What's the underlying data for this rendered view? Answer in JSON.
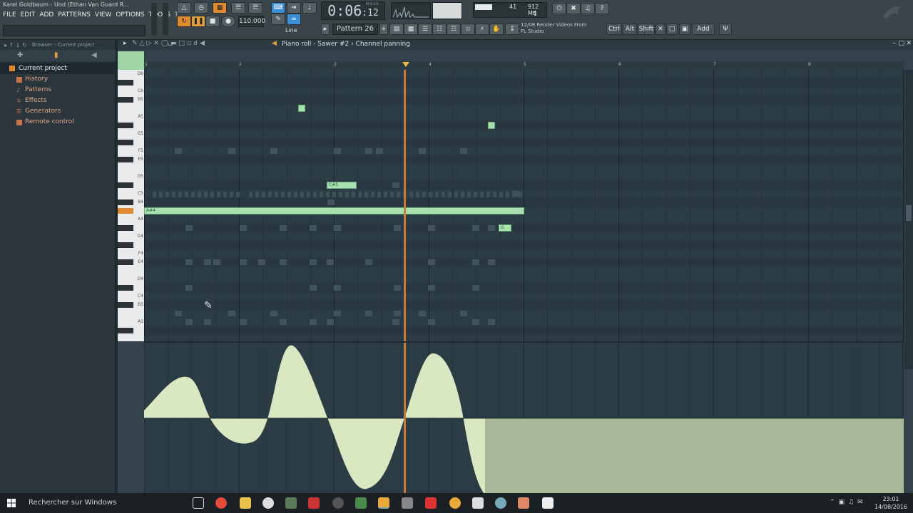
{
  "window": {
    "title": "Karel Goldbaum - Und (Ethan Van Guard R..."
  },
  "menu": [
    "FILE",
    "EDIT",
    "ADD",
    "PATTERNS",
    "VIEW",
    "OPTIONS",
    "TOOLS",
    "?"
  ],
  "transport": {
    "time_main": "0:06",
    "time_ms": ":12",
    "time_unit": "M:S:CS",
    "tempo": "110.000",
    "pattern": "Pattern 26",
    "snap_mode": "Line"
  },
  "monitor": {
    "cpu_value": "41",
    "memory": "912 MB",
    "polyphony": "1"
  },
  "hint": {
    "line1": "12/08  Render Videos From",
    "line2": "FL Studio"
  },
  "modifiers": [
    "Ctrl",
    "Alt",
    "Shift"
  ],
  "add_label": "Add",
  "browser": {
    "header": "Browser - Current project",
    "root": "Current project",
    "items": [
      "History",
      "Patterns",
      "Effects",
      "Generators",
      "Remote control"
    ]
  },
  "piano_roll": {
    "breadcrumb": "Piano roll - Sawer #2 › Channel panning",
    "key_labels": [
      "D6",
      "C6",
      "B5",
      "A5",
      "G5",
      "F5",
      "E5",
      "D5",
      "C5",
      "B4",
      "A4",
      "G4",
      "F4",
      "E4",
      "D4",
      "C4",
      "B3",
      "A3"
    ],
    "bar_numbers": [
      "1",
      "2",
      "3",
      "4",
      "5",
      "6",
      "7",
      "8"
    ],
    "note_labels": {
      "long_note": "A#4",
      "c5_note": "C#5",
      "g4_note": "G"
    }
  },
  "taskbar": {
    "search_placeholder": "Rechercher sur Windows",
    "time": "23:01",
    "date": "14/08/2016"
  },
  "colors": {
    "accent": "#e08a2e",
    "note": "#a8e0b0",
    "automation": "#d9e8c0",
    "playhead": "#c9793a"
  }
}
